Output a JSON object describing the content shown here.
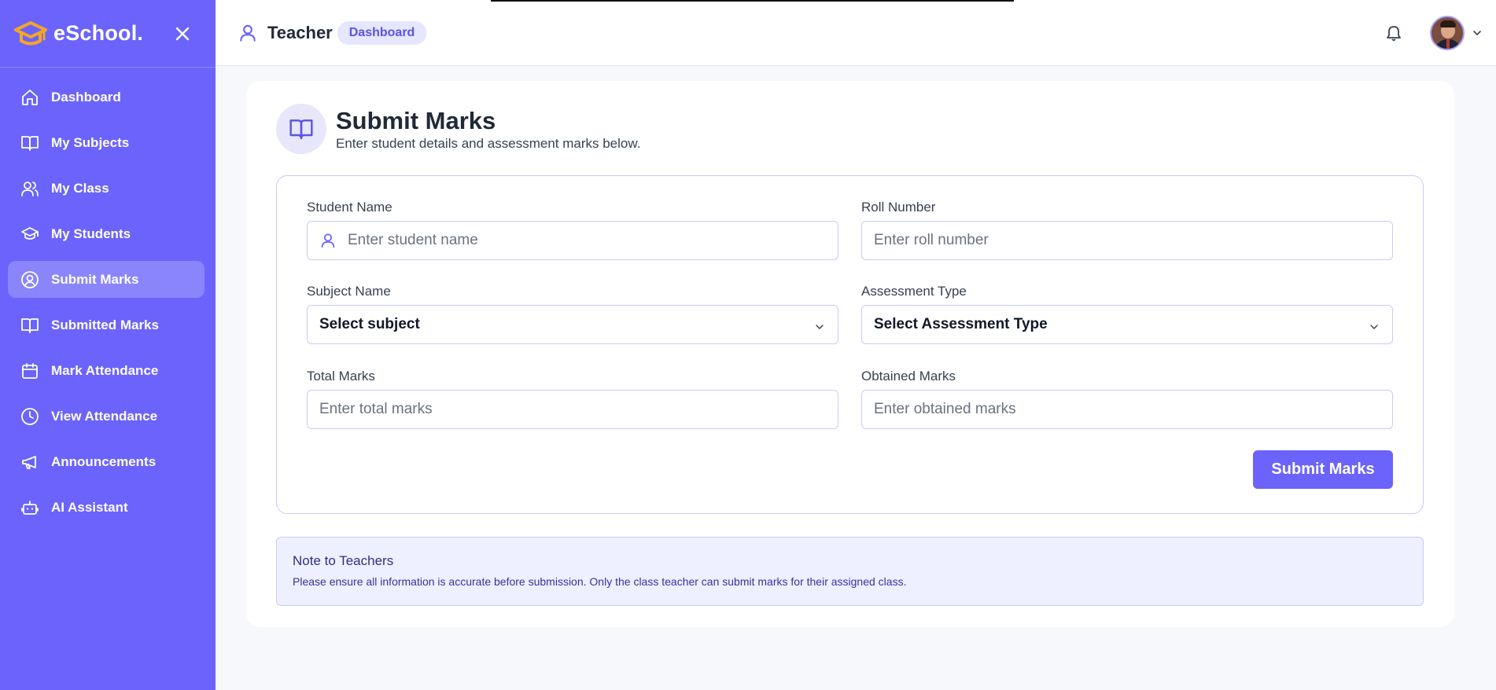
{
  "brand": {
    "name": "eSchool."
  },
  "sidebar": {
    "items": [
      {
        "label": "Dashboard",
        "icon": "home-icon",
        "active": false
      },
      {
        "label": "My Subjects",
        "icon": "book-icon",
        "active": false
      },
      {
        "label": "My Class",
        "icon": "users-icon",
        "active": false
      },
      {
        "label": "My Students",
        "icon": "graduation-cap-icon",
        "active": false
      },
      {
        "label": "Submit Marks",
        "icon": "user-circle-icon",
        "active": true
      },
      {
        "label": "Submitted Marks",
        "icon": "book-open-icon",
        "active": false
      },
      {
        "label": "Mark Attendance",
        "icon": "calendar-icon",
        "active": false
      },
      {
        "label": "View Attendance",
        "icon": "clock-icon",
        "active": false
      },
      {
        "label": "Announcements",
        "icon": "megaphone-icon",
        "active": false
      },
      {
        "label": "AI Assistant",
        "icon": "robot-icon",
        "active": false
      }
    ]
  },
  "header": {
    "role": "Teacher",
    "badge": "Dashboard"
  },
  "page": {
    "title": "Submit Marks",
    "subtitle": "Enter student details and assessment marks below."
  },
  "form": {
    "student_name": {
      "label": "Student Name",
      "placeholder": "Enter student name"
    },
    "roll_number": {
      "label": "Roll Number",
      "placeholder": "Enter roll number"
    },
    "subject_name": {
      "label": "Subject Name",
      "selected": "Select subject"
    },
    "assessment_type": {
      "label": "Assessment Type",
      "selected": "Select Assessment Type"
    },
    "total_marks": {
      "label": "Total Marks",
      "placeholder": "Enter total marks"
    },
    "obtained_marks": {
      "label": "Obtained Marks",
      "placeholder": "Enter obtained marks"
    },
    "submit_label": "Submit Marks"
  },
  "note": {
    "title": "Note to Teachers",
    "text": "Please ensure all information is accurate before submission. Only the class teacher can submit marks for their assigned class."
  },
  "colors": {
    "primary": "#6b63fb",
    "badge_bg": "#e5e7ff",
    "note_bg": "#eef0ff",
    "logo_accent": "#f5a623"
  }
}
